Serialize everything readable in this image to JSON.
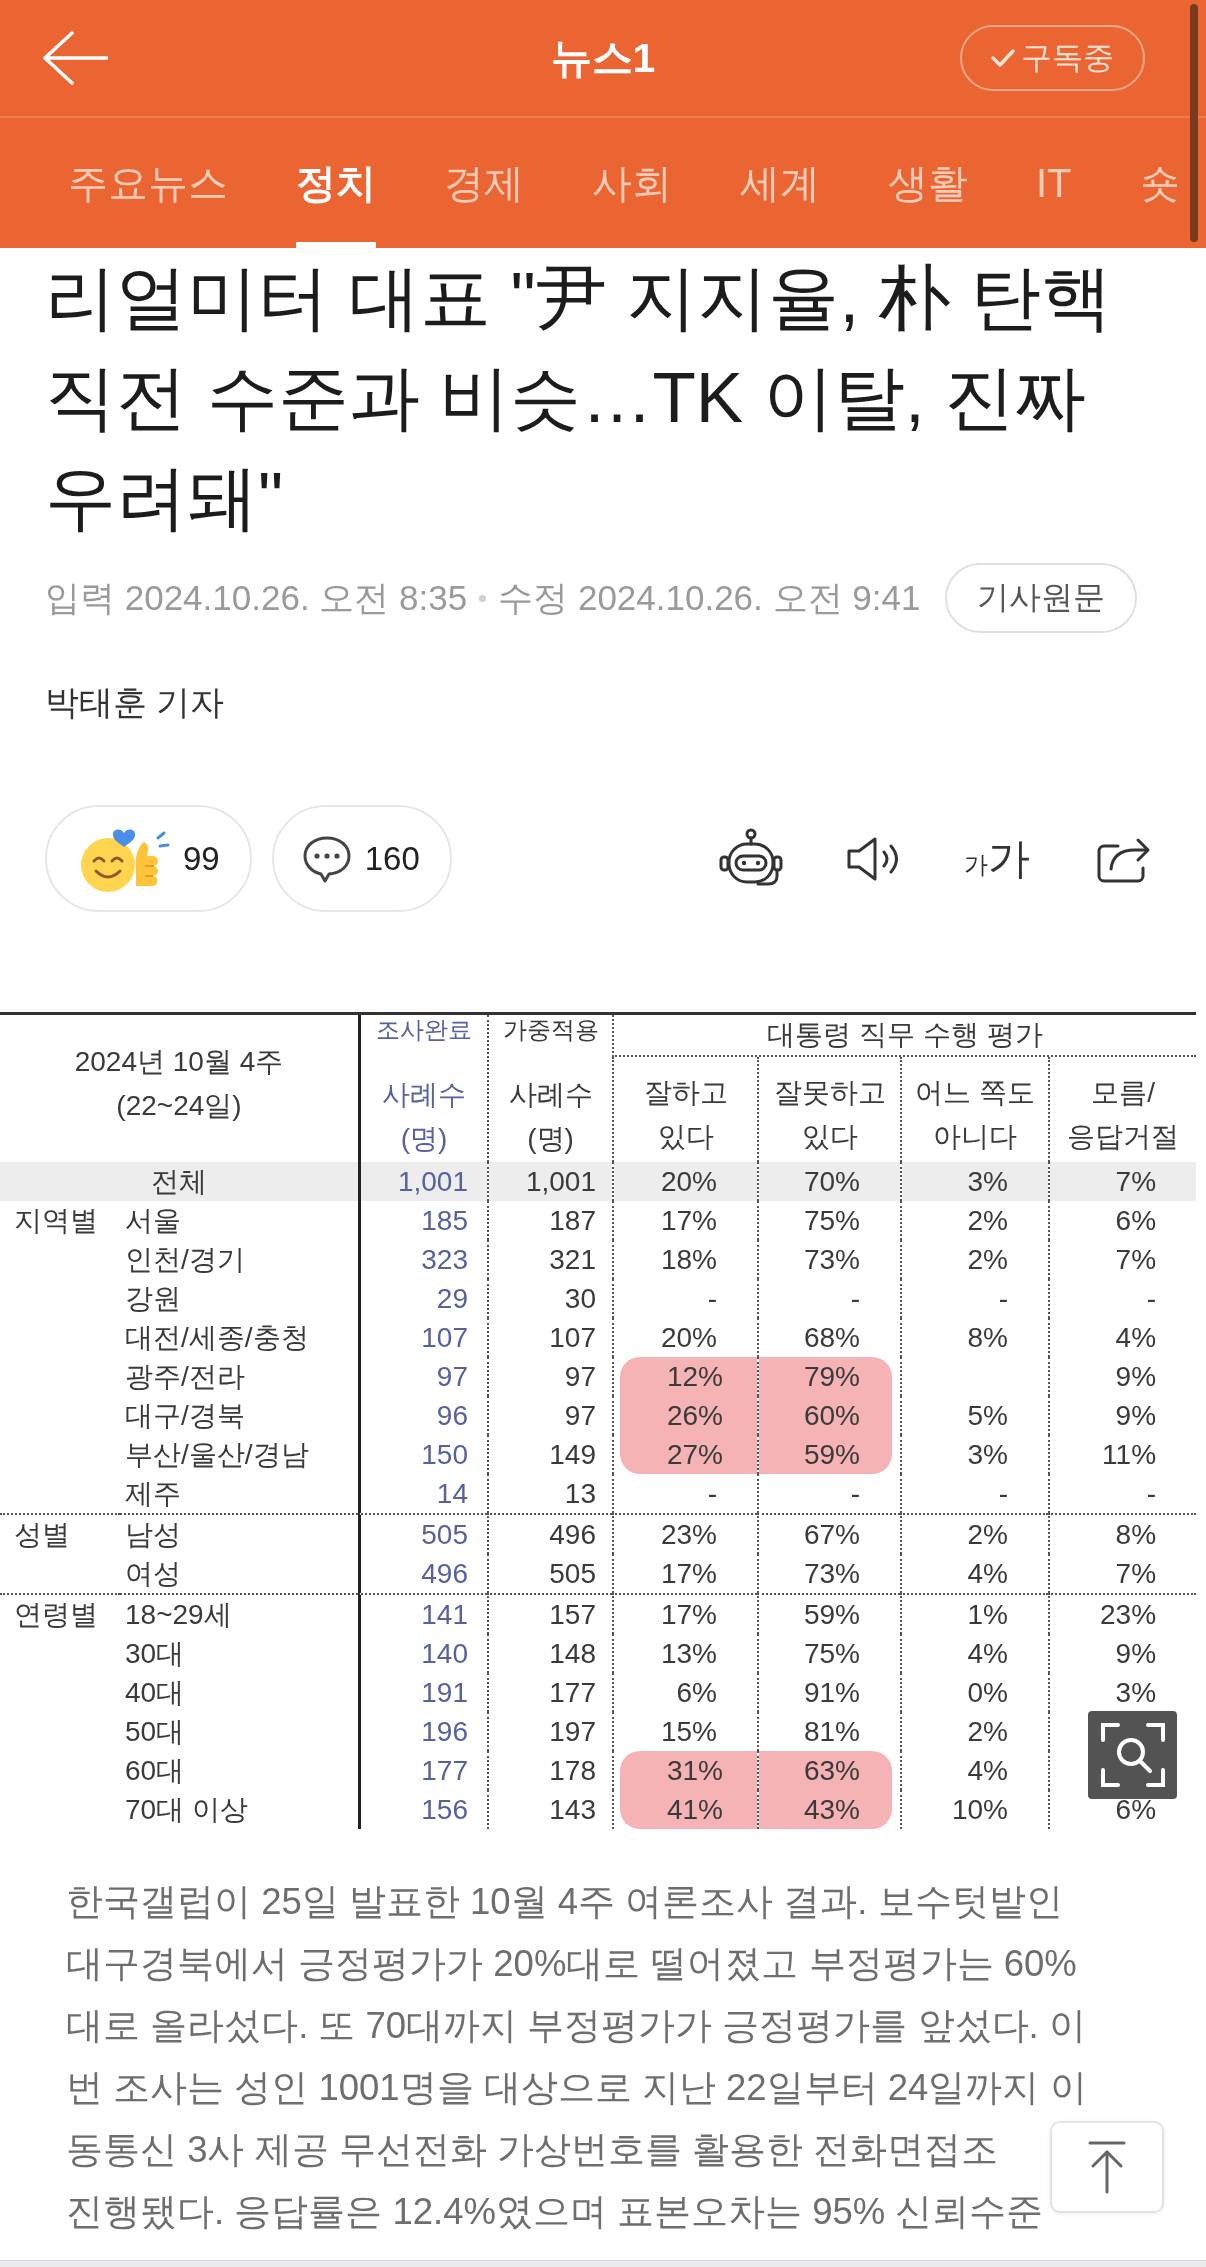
{
  "header": {
    "title": "뉴스1",
    "subscribe_button": {
      "label": "구독중",
      "subscribed": true
    }
  },
  "tabs": [
    {
      "label": "주요뉴스",
      "selected": false
    },
    {
      "label": "정치",
      "selected": true
    },
    {
      "label": "경제",
      "selected": false
    },
    {
      "label": "사회",
      "selected": false
    },
    {
      "label": "세계",
      "selected": false
    },
    {
      "label": "생활",
      "selected": false
    },
    {
      "label": "IT",
      "selected": false
    },
    {
      "label": "숏",
      "selected": false
    }
  ],
  "article": {
    "title": "리얼미터 대표 \"尹 지지율, 朴 탄핵 직전 수준과 비슷…TK 이탈, 진짜 우려돼\"",
    "published": "입력 2024.10.26. 오전 8:35",
    "modified": "수정 2024.10.26. 오전 9:41",
    "original_button": "기사원문",
    "reporter": "박태훈 기자",
    "reaction_count": "99",
    "comment_count": "160",
    "font_size_button": {
      "small": "가",
      "large": "가"
    }
  },
  "table_image": {
    "period": "2024년 10월 4주",
    "dates": "(22~24일)",
    "count_columns": [
      {
        "kind": "completed",
        "lines": [
          "조사완료",
          "사례수",
          "(명)"
        ]
      },
      {
        "kind": "weighted",
        "lines": [
          "가중적용",
          "사례수",
          "(명)"
        ]
      }
    ],
    "rating_title": "대통령 직무 수행 평가",
    "rating_columns": [
      {
        "lines": [
          "잘하고",
          "있다"
        ]
      },
      {
        "lines": [
          "잘못하고",
          "있다"
        ]
      },
      {
        "lines": [
          "어느 쪽도",
          "아니다"
        ]
      },
      {
        "lines": [
          "모름/",
          "응답거절"
        ]
      }
    ],
    "total_row": {
      "label": "전체",
      "cells": {
        "completed": "1,001",
        "weighted": "1,001",
        "doing_well": "20%",
        "doing_badly": "70%",
        "neither": "3%",
        "no_answer": "7%"
      }
    },
    "groups": [
      {
        "label": "지역별",
        "rows": [
          {
            "label": "서울",
            "cells": {
              "completed": "185",
              "weighted": "187",
              "doing_well": "17%",
              "doing_badly": "75%",
              "neither": "2%",
              "no_answer": "6%"
            },
            "highlighted": false
          },
          {
            "label": "인천/경기",
            "cells": {
              "completed": "323",
              "weighted": "321",
              "doing_well": "18%",
              "doing_badly": "73%",
              "neither": "2%",
              "no_answer": "7%"
            },
            "highlighted": false
          },
          {
            "label": "강원",
            "cells": {
              "completed": "29",
              "weighted": "30",
              "doing_well": "-",
              "doing_badly": "-",
              "neither": "-",
              "no_answer": "-"
            },
            "highlighted": false
          },
          {
            "label": "대전/세종/충청",
            "cells": {
              "completed": "107",
              "weighted": "107",
              "doing_well": "20%",
              "doing_badly": "68%",
              "neither": "8%",
              "no_answer": "4%"
            },
            "highlighted": false
          },
          {
            "label": "광주/전라",
            "cells": {
              "completed": "97",
              "weighted": "97",
              "doing_well": "12%",
              "doing_badly": "79%",
              "no_answer": "9%"
            },
            "highlighted": true
          },
          {
            "label": "대구/경북",
            "cells": {
              "completed": "96",
              "weighted": "97",
              "doing_well": "26%",
              "doing_badly": "60%",
              "neither": "5%",
              "no_answer": "9%"
            },
            "highlighted": true
          },
          {
            "label": "부산/울산/경남",
            "cells": {
              "completed": "150",
              "weighted": "149",
              "doing_well": "27%",
              "doing_badly": "59%",
              "neither": "3%",
              "no_answer": "11%"
            },
            "highlighted": true
          },
          {
            "label": "제주",
            "cells": {
              "completed": "14",
              "weighted": "13",
              "doing_well": "-",
              "doing_badly": "-",
              "neither": "-",
              "no_answer": "-"
            },
            "highlighted": false
          }
        ]
      },
      {
        "label": "성별",
        "rows": [
          {
            "label": "남성",
            "cells": {
              "completed": "505",
              "weighted": "496",
              "doing_well": "23%",
              "doing_badly": "67%",
              "neither": "2%",
              "no_answer": "8%"
            },
            "highlighted": false
          },
          {
            "label": "여성",
            "cells": {
              "completed": "496",
              "weighted": "505",
              "doing_well": "17%",
              "doing_badly": "73%",
              "neither": "4%",
              "no_answer": "7%"
            },
            "highlighted": false
          }
        ]
      },
      {
        "label": "연령별",
        "rows": [
          {
            "label": "18~29세",
            "cells": {
              "completed": "141",
              "weighted": "157",
              "doing_well": "17%",
              "doing_badly": "59%",
              "neither": "1%",
              "no_answer": "23%"
            },
            "highlighted": false
          },
          {
            "label": "30대",
            "cells": {
              "completed": "140",
              "weighted": "148",
              "doing_well": "13%",
              "doing_badly": "75%",
              "neither": "4%",
              "no_answer": "9%"
            },
            "highlighted": false
          },
          {
            "label": "40대",
            "cells": {
              "completed": "191",
              "weighted": "177",
              "doing_well": "6%",
              "doing_badly": "91%",
              "neither": "0%",
              "no_answer": "3%"
            },
            "highlighted": false
          },
          {
            "label": "50대",
            "cells": {
              "completed": "196",
              "weighted": "197",
              "doing_well": "15%",
              "doing_badly": "81%",
              "neither": "2%"
            },
            "highlighted": false
          },
          {
            "label": "60대",
            "cells": {
              "completed": "177",
              "weighted": "178",
              "doing_well": "31%",
              "doing_badly": "63%",
              "neither": "4%"
            },
            "highlighted": true
          },
          {
            "label": "70대 이상",
            "cells": {
              "completed": "156",
              "weighted": "143",
              "doing_well": "41%",
              "doing_badly": "43%",
              "neither": "10%",
              "no_answer": "6%"
            },
            "highlighted": true
          }
        ]
      }
    ]
  },
  "caption_lines": [
    "한국갤럽이 25일 발표한 10월 4주 여론조사 결과. 보수텃밭인",
    "대구경북에서 긍정평가가 20%대로 떨어졌고 부정평가는 60%",
    "대로 올라섰다. 또 70대까지 부정평가가 긍정평가를 앞섰다. 이",
    "번 조사는 성인 1001명을 대상으로 지난 22일부터 24일까지 이",
    "동통신 3사 제공 무선전화 가상번호를 활용한 전화면접조",
    "진행됐다. 응답률은 12.4%였으며 표본오차는 95% 신뢰수준"
  ]
}
